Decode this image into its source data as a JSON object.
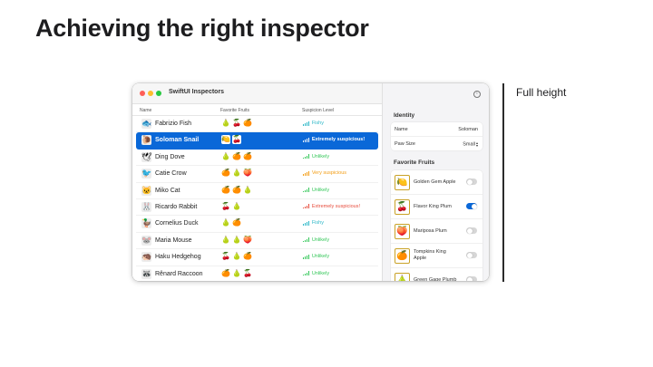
{
  "slide": {
    "title": "Achieving the right inspector",
    "annotation": "Full height"
  },
  "window": {
    "title": "SwiftUI Inspectors",
    "columns": {
      "name": "Name",
      "fruits": "Favorite Fruits",
      "suspicion": "Suspicion Level"
    },
    "rows": [
      {
        "avatar": "🐟",
        "name": "Fabrizio Fish",
        "fruits": [
          "🍐",
          "🍒",
          "🍊"
        ],
        "suspicion": "Fishy",
        "color": "#2bb7c7",
        "selected": false
      },
      {
        "avatar": "🐌",
        "name": "Soloman Snail",
        "fruits": [
          "🍋",
          "🍒"
        ],
        "suspicion": "Extremely suspicious!",
        "color": "#ffffff",
        "selected": true
      },
      {
        "avatar": "🕊",
        "name": "Ding Dove",
        "fruits": [
          "🍐",
          "🍊",
          "🍊"
        ],
        "suspicion": "Unlikely",
        "color": "#34c759",
        "selected": false
      },
      {
        "avatar": "🐦",
        "name": "Catie Crow",
        "fruits": [
          "🍊",
          "🍐",
          "🍑"
        ],
        "suspicion": "Very suspicious",
        "color": "#f39c12",
        "selected": false
      },
      {
        "avatar": "🐱",
        "name": "Miko Cat",
        "fruits": [
          "🍊",
          "🍊",
          "🍐"
        ],
        "suspicion": "Unlikely",
        "color": "#34c759",
        "selected": false
      },
      {
        "avatar": "🐰",
        "name": "Ricardo Rabbit",
        "fruits": [
          "🍒",
          "🍐"
        ],
        "suspicion": "Extremely suspicious!",
        "color": "#e74c3c",
        "selected": false
      },
      {
        "avatar": "🦆",
        "name": "Cornelius Duck",
        "fruits": [
          "🍐",
          "🍊"
        ],
        "suspicion": "Fishy",
        "color": "#2bb7c7",
        "selected": false
      },
      {
        "avatar": "🐭",
        "name": "Maria Mouse",
        "fruits": [
          "🍐",
          "🍐",
          "🍑"
        ],
        "suspicion": "Unlikely",
        "color": "#34c759",
        "selected": false
      },
      {
        "avatar": "🦔",
        "name": "Haku Hedgehog",
        "fruits": [
          "🍒",
          "🍐",
          "🍊"
        ],
        "suspicion": "Unlikely",
        "color": "#34c759",
        "selected": false
      },
      {
        "avatar": "🦝",
        "name": "Rênard Raccoon",
        "fruits": [
          "🍊",
          "🍐",
          "🍒"
        ],
        "suspicion": "Unlikely",
        "color": "#34c759",
        "selected": false
      }
    ]
  },
  "inspector": {
    "identity_header": "Identity",
    "name_label": "Name",
    "name_value": "Soloman",
    "paw_label": "Paw Size",
    "paw_value": "Small",
    "fruits_header": "Favorite Fruits",
    "fruits": [
      {
        "icon": "🍋",
        "label": "Golden Gem Apple",
        "on": false
      },
      {
        "icon": "🍒",
        "label": "Flavor King Plum",
        "on": true
      },
      {
        "icon": "🍑",
        "label": "Mariposa Plum",
        "on": false
      },
      {
        "icon": "🍊",
        "label": "Tompkins King Apple",
        "on": false
      },
      {
        "icon": "🍐",
        "label": "Green Gage Plumb",
        "on": false
      }
    ]
  },
  "icons": {
    "info": "info-icon",
    "stepper": "stepper-icon"
  }
}
